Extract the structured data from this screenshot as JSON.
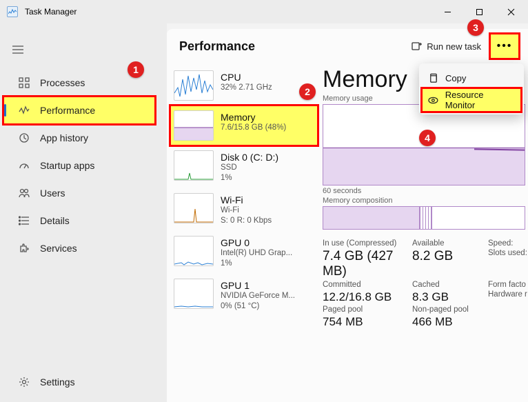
{
  "window": {
    "title": "Task Manager"
  },
  "sidebar": {
    "items": [
      {
        "label": "Processes"
      },
      {
        "label": "Performance"
      },
      {
        "label": "App history"
      },
      {
        "label": "Startup apps"
      },
      {
        "label": "Users"
      },
      {
        "label": "Details"
      },
      {
        "label": "Services"
      }
    ],
    "settings_label": "Settings"
  },
  "content": {
    "title": "Performance",
    "run_task_label": "Run new task"
  },
  "perf_list": [
    {
      "name": "CPU",
      "sub1": "32% 2.71 GHz",
      "sub2": "",
      "color": "#2a7fd4"
    },
    {
      "name": "Memory",
      "sub1": "7.6/15.8 GB (48%)",
      "sub2": "",
      "color": "#8040a0"
    },
    {
      "name": "Disk 0 (C: D:)",
      "sub1": "SSD",
      "sub2": "1%",
      "color": "#2a9d3a"
    },
    {
      "name": "Wi-Fi",
      "sub1": "Wi-Fi",
      "sub2": "S: 0 R: 0 Kbps",
      "color": "#c06a00"
    },
    {
      "name": "GPU 0",
      "sub1": "Intel(R) UHD Grap...",
      "sub2": "1%",
      "color": "#2a7fd4"
    },
    {
      "name": "GPU 1",
      "sub1": "NVIDIA GeForce M...",
      "sub2": "0% (51 °C)",
      "color": "#2a7fd4"
    }
  ],
  "detail": {
    "title": "Memory",
    "usage_label": "Memory usage",
    "x_label": "60 seconds",
    "composition_label": "Memory composition",
    "stats": {
      "inuse_label": "In use (Compressed)",
      "inuse_val": "7.4 GB (427 MB)",
      "avail_label": "Available",
      "avail_val": "8.2 GB",
      "speed_label": "Speed:",
      "slots_label": "Slots used:",
      "form_label": "Form facto",
      "hw_label": "Hardware r",
      "committed_label": "Committed",
      "committed_val": "12.2/16.8 GB",
      "cached_label": "Cached",
      "cached_val": "8.3 GB",
      "paged_label": "Paged pool",
      "paged_val": "754 MB",
      "nonpaged_label": "Non-paged pool",
      "nonpaged_val": "466 MB"
    }
  },
  "context_menu": {
    "copy_label": "Copy",
    "resource_monitor_label": "Resource Monitor"
  },
  "markers": {
    "1": "1",
    "2": "2",
    "3": "3",
    "4": "4"
  },
  "chart_data": {
    "type": "area",
    "title": "Memory usage",
    "xlabel": "60 seconds",
    "ylabel": "",
    "ylim": [
      0,
      15.8
    ],
    "series": [
      {
        "name": "In use",
        "values": [
          7.4,
          7.4,
          7.4,
          7.4,
          7.4,
          7.4,
          7.4,
          7.4,
          7.5,
          7.5,
          7.5,
          7.6
        ]
      }
    ]
  }
}
